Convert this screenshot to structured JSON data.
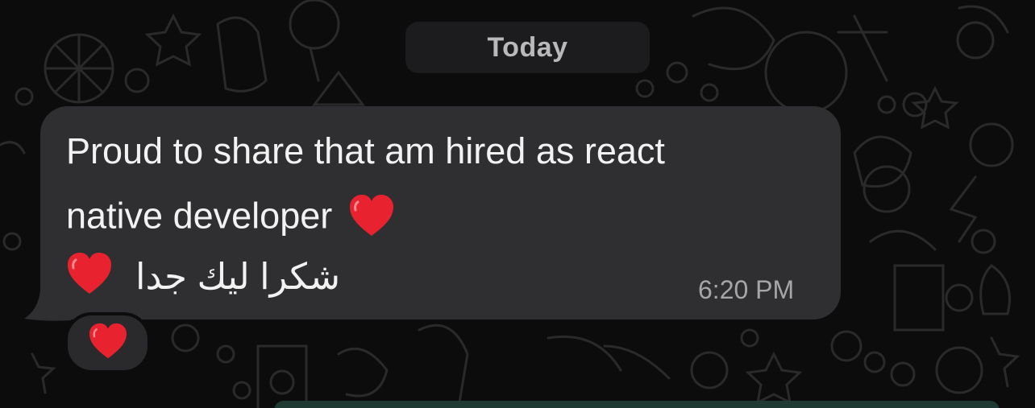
{
  "date_separator": {
    "label": "Today"
  },
  "message": {
    "line1": "Proud to share that am hired as react",
    "line2": "native developer",
    "line3_arabic": "شكرا ليك جدا",
    "timestamp": "6:20 PM",
    "inline_emoji_1": "red-heart",
    "inline_emoji_2": "red-heart"
  },
  "reaction": {
    "emoji": "red-heart"
  },
  "colors": {
    "background": "#0c0c0c",
    "bubble": "#2f2f31",
    "heart": "#e8232f",
    "chip": "#1c1c1e"
  }
}
